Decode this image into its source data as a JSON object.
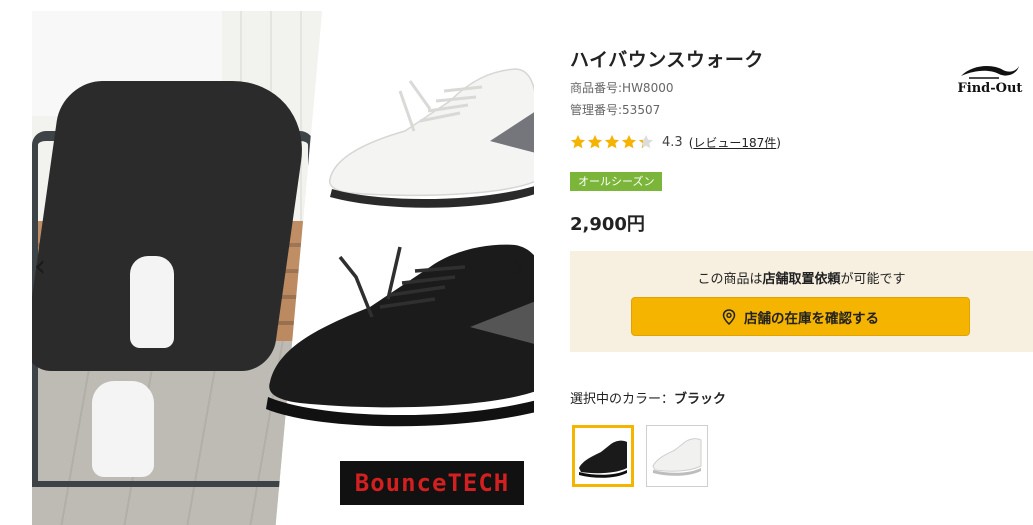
{
  "product": {
    "title": "ハイバウンスウォーク",
    "item_number_label": "商品番号:",
    "item_number": "HW8000",
    "control_number_label": "管理番号:",
    "control_number": "53507",
    "rating_value": "4.3",
    "rating_stars": 4.3,
    "review_prefix": "(",
    "review_text": "レビュー187件",
    "review_suffix": ")",
    "season_badge": "オールシーズン",
    "price": "2,900円",
    "maker_logo_text": "Find-Out"
  },
  "store": {
    "note_pre": "この商品は",
    "note_bold": "店舗取置依頼",
    "note_post": "が可能です",
    "button_label": "店舗の在庫を確認する",
    "button_icon": "location-pin-icon"
  },
  "colors": {
    "label_prefix": "選択中のカラー：",
    "selected": "ブラック",
    "options": [
      "ブラック",
      "ホワイト"
    ]
  },
  "gallery": {
    "brand_logo_text": "BounceTECH",
    "prev_symbol": "‹",
    "next_symbol": "›"
  },
  "theme": {
    "accent": "#f5b400",
    "badge_green": "#7bb63b",
    "store_bg": "#f7f0e1",
    "star_color": "#f5b400",
    "logo_red": "#d21f1f"
  }
}
